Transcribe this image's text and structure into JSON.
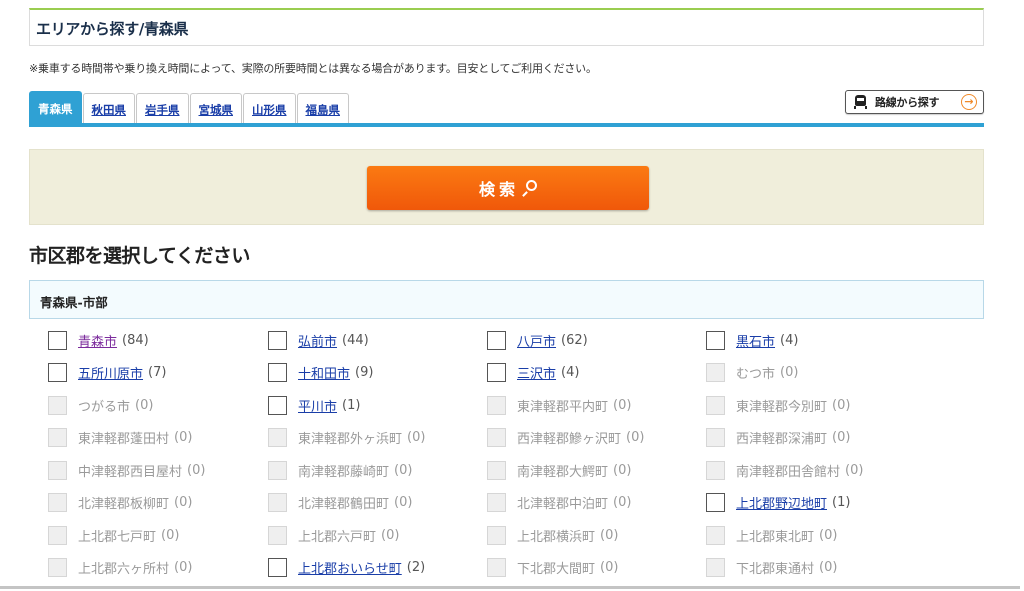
{
  "header": {
    "title": "エリアから探す/青森県"
  },
  "notice": "※乗車する時間帯や乗り換え時間によって、実際の所要時間とは異なる場合があります。目安としてご利用ください。",
  "tabs": [
    {
      "label": "青森県",
      "active": true
    },
    {
      "label": "秋田県",
      "active": false
    },
    {
      "label": "岩手県",
      "active": false
    },
    {
      "label": "宮城県",
      "active": false
    },
    {
      "label": "山形県",
      "active": false
    },
    {
      "label": "福島県",
      "active": false
    }
  ],
  "route_button": {
    "label": "路線から探す",
    "icon": "train-icon",
    "arrow_icon": "arrow-right-circle-icon",
    "arrow_glyph": "→"
  },
  "search_button": {
    "label": "検索",
    "icon": "search-icon"
  },
  "section_title": "市区郡を選択してください",
  "group": {
    "title": "青森県-市部",
    "cities": [
      {
        "name": "青森市",
        "count": "(84)",
        "enabled": true,
        "visited": true
      },
      {
        "name": "弘前市",
        "count": "(44)",
        "enabled": true
      },
      {
        "name": "八戸市",
        "count": "(62)",
        "enabled": true
      },
      {
        "name": "黒石市",
        "count": "(4)",
        "enabled": true
      },
      {
        "name": "五所川原市",
        "count": "(7)",
        "enabled": true
      },
      {
        "name": "十和田市",
        "count": "(9)",
        "enabled": true
      },
      {
        "name": "三沢市",
        "count": "(4)",
        "enabled": true
      },
      {
        "name": "むつ市",
        "count": "(0)",
        "enabled": false
      },
      {
        "name": "つがる市",
        "count": "(0)",
        "enabled": false
      },
      {
        "name": "平川市",
        "count": "(1)",
        "enabled": true
      },
      {
        "name": "東津軽郡平内町",
        "count": "(0)",
        "enabled": false
      },
      {
        "name": "東津軽郡今別町",
        "count": "(0)",
        "enabled": false
      },
      {
        "name": "東津軽郡蓬田村",
        "count": "(0)",
        "enabled": false
      },
      {
        "name": "東津軽郡外ヶ浜町",
        "count": "(0)",
        "enabled": false
      },
      {
        "name": "西津軽郡鰺ヶ沢町",
        "count": "(0)",
        "enabled": false
      },
      {
        "name": "西津軽郡深浦町",
        "count": "(0)",
        "enabled": false
      },
      {
        "name": "中津軽郡西目屋村",
        "count": "(0)",
        "enabled": false
      },
      {
        "name": "南津軽郡藤崎町",
        "count": "(0)",
        "enabled": false
      },
      {
        "name": "南津軽郡大鰐町",
        "count": "(0)",
        "enabled": false
      },
      {
        "name": "南津軽郡田舎館村",
        "count": "(0)",
        "enabled": false
      },
      {
        "name": "北津軽郡板柳町",
        "count": "(0)",
        "enabled": false
      },
      {
        "name": "北津軽郡鶴田町",
        "count": "(0)",
        "enabled": false
      },
      {
        "name": "北津軽郡中泊町",
        "count": "(0)",
        "enabled": false
      },
      {
        "name": "上北郡野辺地町",
        "count": "(1)",
        "enabled": true
      },
      {
        "name": "上北郡七戸町",
        "count": "(0)",
        "enabled": false
      },
      {
        "name": "上北郡六戸町",
        "count": "(0)",
        "enabled": false
      },
      {
        "name": "上北郡横浜町",
        "count": "(0)",
        "enabled": false
      },
      {
        "name": "上北郡東北町",
        "count": "(0)",
        "enabled": false
      },
      {
        "name": "上北郡六ヶ所村",
        "count": "(0)",
        "enabled": false
      },
      {
        "name": "上北郡おいらせ町",
        "count": "(2)",
        "enabled": true
      },
      {
        "name": "下北郡大間町",
        "count": "(0)",
        "enabled": false
      },
      {
        "name": "下北郡東通村",
        "count": "(0)",
        "enabled": false
      }
    ]
  },
  "colors": {
    "accent_blue": "#2fa1d4",
    "search_orange": "#f76a0e",
    "header_green": "#9acd50",
    "link": "#1a3ea8",
    "visited_link": "#7b2a9c",
    "disabled_text": "#9a9a9a"
  }
}
